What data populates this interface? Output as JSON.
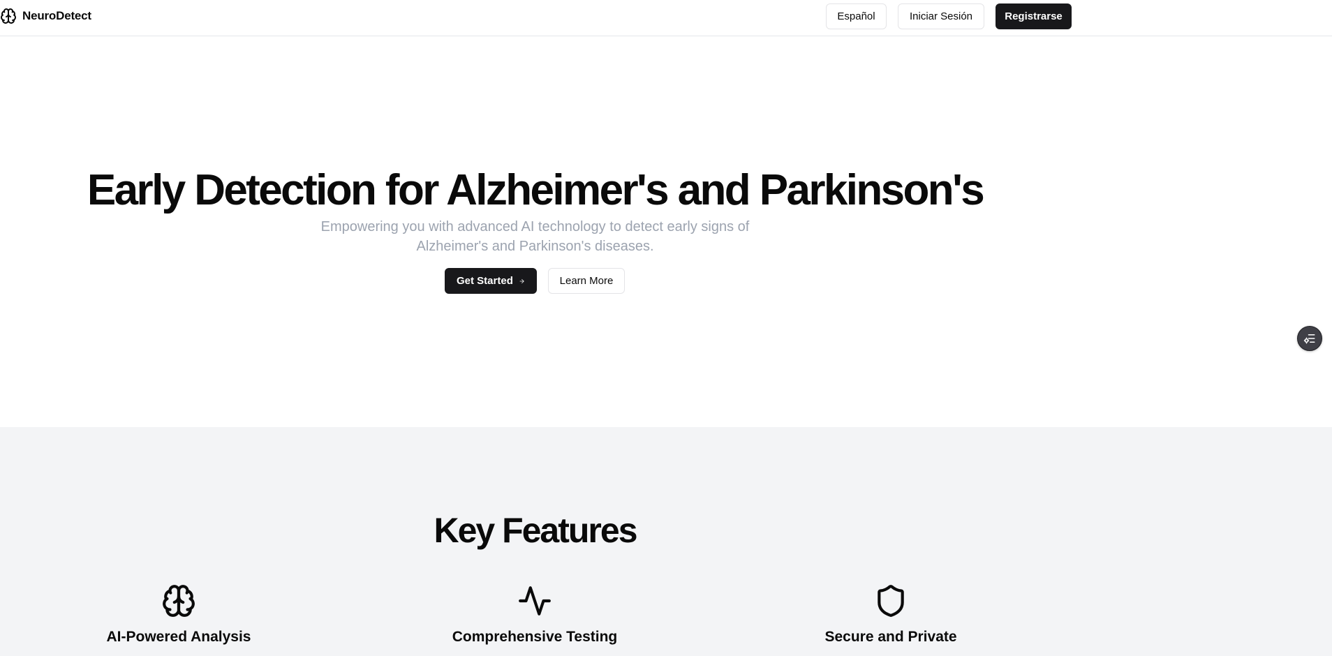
{
  "header": {
    "brand": {
      "name": "NeuroDetect",
      "icon": "brain-icon"
    },
    "nav": {
      "language_label": "Español",
      "login_label": "Iniciar Sesión",
      "register_label": "Registrarse"
    }
  },
  "hero": {
    "title": "Early Detection for Alzheimer's and Parkinson's",
    "subtitle": "Empowering you with advanced AI technology to detect early signs of Alzheimer's and Parkinson's diseases.",
    "primary_cta": {
      "label": "Get Started",
      "icon": "arrow-right-icon"
    },
    "secondary_cta": {
      "label": "Learn More"
    }
  },
  "floating_widget": {
    "icon": "settings-list-icon"
  },
  "features": {
    "title": "Key Features",
    "items": [
      {
        "icon": "brain-icon",
        "title": "AI-Powered Analysis"
      },
      {
        "icon": "activity-icon",
        "title": "Comprehensive Testing"
      },
      {
        "icon": "shield-icon",
        "title": "Secure and Private"
      }
    ]
  },
  "colors": {
    "primary": "#18181b",
    "text": "#0a0a0a",
    "muted_text": "#9ca3af",
    "section_background": "#f3f4f6",
    "border": "#e4e4e7"
  }
}
